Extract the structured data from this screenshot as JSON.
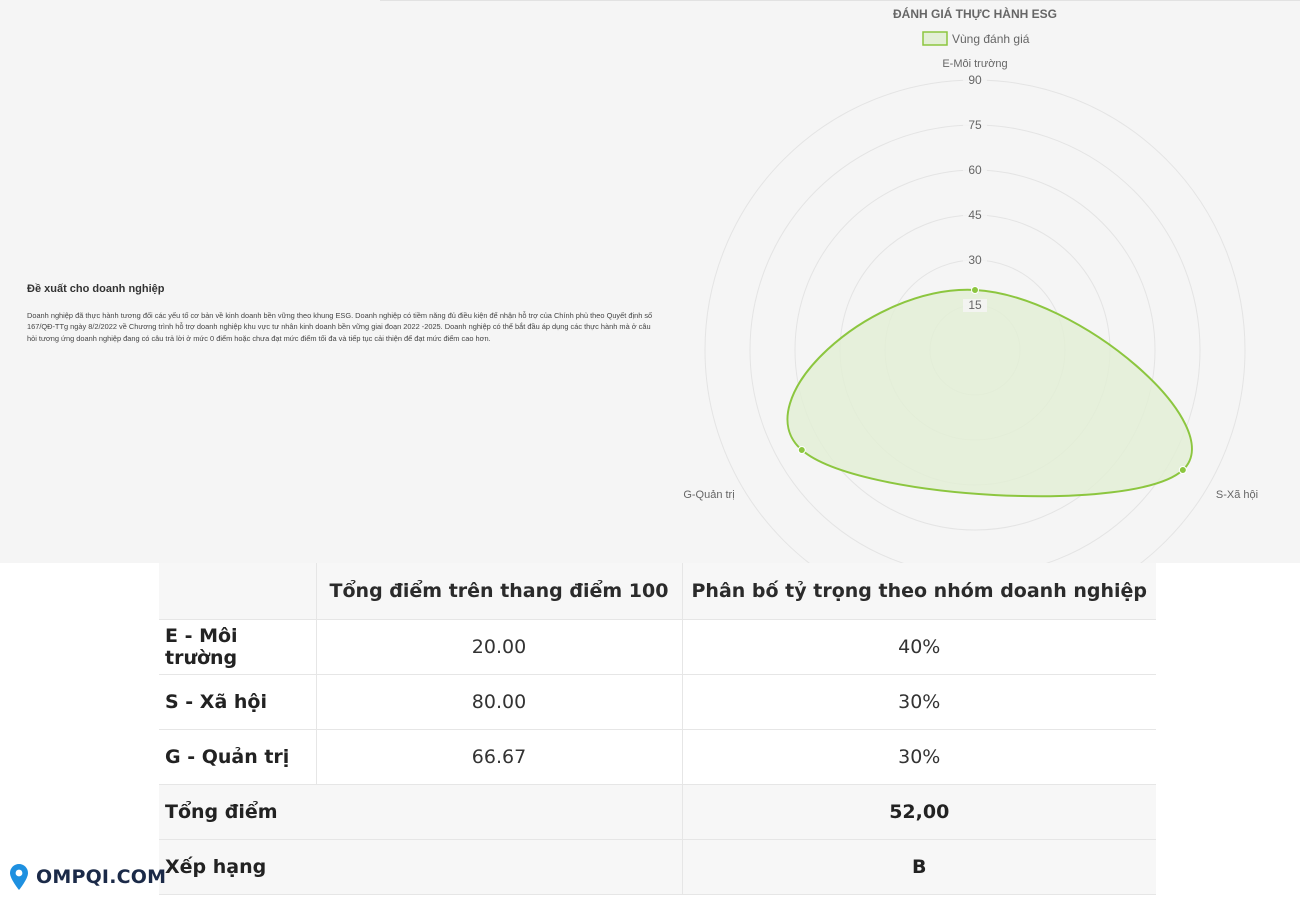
{
  "recommendation": {
    "title": "Đề xuất cho doanh nghiệp",
    "text": "Doanh nghiệp đã thực hành tương đối các yếu tố cơ bản về kinh doanh bền vững theo khung ESG. Doanh nghiệp có tiềm năng đủ điều kiện để nhận hỗ trợ của Chính phủ theo Quyết định số 167/QĐ-TTg ngày 8/2/2022 về Chương trình hỗ trợ doanh nghiệp khu vực tư nhân kinh doanh bền vững giai đoạn 2022 -2025. Doanh nghiệp có thể bắt đầu áp dụng các thực hành mà ở câu hỏi tương ứng doanh nghiệp đang có câu trả lời ở mức 0 điểm hoặc chưa đạt mức điểm tối đa và tiếp tục cải thiện để đạt mức điểm cao hơn."
  },
  "chart_data": {
    "type": "radar",
    "title": "ĐÁNH GIÁ THỰC HÀNH ESG",
    "legend": {
      "label": "Vùng đánh giá",
      "position": "top"
    },
    "categories": [
      "E-Môi trường",
      "S-Xã hội",
      "G-Quản trị"
    ],
    "series": [
      {
        "name": "Vùng đánh giá",
        "values": [
          20,
          80,
          66.67
        ]
      }
    ],
    "r_range": [
      0,
      90
    ],
    "r_ticks": [
      15,
      30,
      45,
      60,
      75,
      90
    ],
    "grid": true,
    "line_color": "#8cc63f",
    "fill_color": "#e3efd6"
  },
  "table": {
    "headers": [
      "",
      "Tổng điểm trên thang điểm 100",
      "Phân bố tỷ trọng theo nhóm doanh nghiệp"
    ],
    "rows": [
      {
        "label": "E - Môi trường",
        "score": "20.00",
        "weight": "40%"
      },
      {
        "label": "S - Xã hội",
        "score": "80.00",
        "weight": "30%"
      },
      {
        "label": "G - Quản trị",
        "score": "66.67",
        "weight": "30%"
      }
    ],
    "total": {
      "label": "Tổng điểm",
      "value": "52,00"
    },
    "rank": {
      "label": "Xếp hạng",
      "value": "B"
    }
  },
  "logo": {
    "text": "OMPQI.COM",
    "icon": "map-pin-icon",
    "color": "#1e90e0"
  }
}
